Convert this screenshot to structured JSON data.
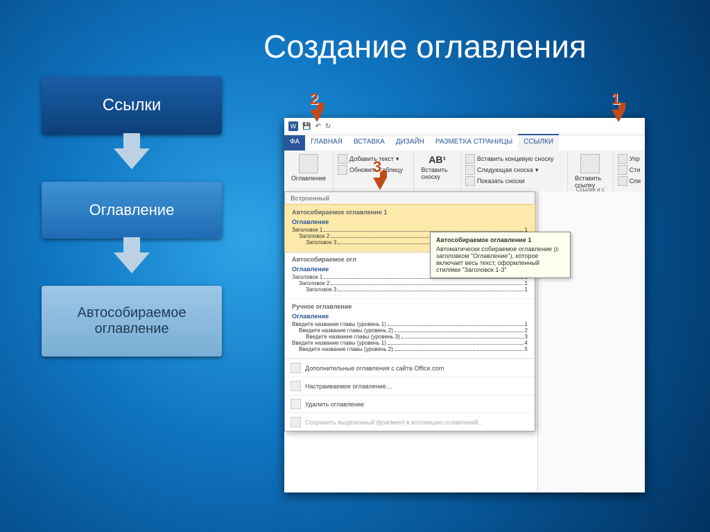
{
  "slide_title": "Создание оглавления",
  "flow": {
    "box1": "Ссылки",
    "box2": "Оглавление",
    "box3": "Автособираемое оглавление"
  },
  "callouts": {
    "n1": "1",
    "n2": "2",
    "n3": "3"
  },
  "word": {
    "tabs": {
      "file": "ФА",
      "home": "ГЛАВНАЯ",
      "insert": "ВСТАВКА",
      "design": "ДИЗАЙН",
      "layout": "РАЗМЕТКА СТРАНИЦЫ",
      "refs": "ССЫЛКИ"
    },
    "ribbon": {
      "toc_btn": "Оглавление",
      "add_text": "Добавить текст",
      "update_table": "Обновить таблицу",
      "insert_footnote": "Вставить сноску",
      "ab_label": "AB¹",
      "insert_endnote": "Вставить концевую сноску",
      "next_footnote": "Следующая сноска",
      "show_notes": "Показать сноски",
      "insert_link": "Вставить ссылку",
      "manage": "Упр",
      "style": "Сти",
      "list": "Спи",
      "group_links": "Ссылки и с"
    },
    "gallery": {
      "builtin": "Встроенный",
      "auto1": "Автособираемое оглавление 1",
      "auto2_prefix": "Автособираемое огл",
      "manual": "Ручное оглавление",
      "heading_label": "Оглавление",
      "h1": "Заголовок 1",
      "h2": "Заголовок 2",
      "h3": "Заголовок 3",
      "m1": "Введите название главы (уровень 1)",
      "m2": "Введите название главы (уровень 2)",
      "m3": "Введите название главы (уровень 3)",
      "m4": "Введите название главы (уровень 1)",
      "m5": "Введите название главы (уровень 2)",
      "p1": "1",
      "p2": "2",
      "p3": "3",
      "p4": "4",
      "p5": "5",
      "more": "Дополнительные оглавления с сайта Office.com",
      "custom": "Настраиваемое оглавление…",
      "remove": "Удалить оглавление",
      "save": "Сохранить выделенный фрагмент в коллекцию оглавлений…"
    },
    "tooltip": {
      "title": "Автособираемое оглавление 1",
      "body": "Автоматически собираемое оглавление (с заголовком \"Оглавление\"), которое включает весь текст, оформленный стилями \"Заголовок 1-3\""
    }
  }
}
